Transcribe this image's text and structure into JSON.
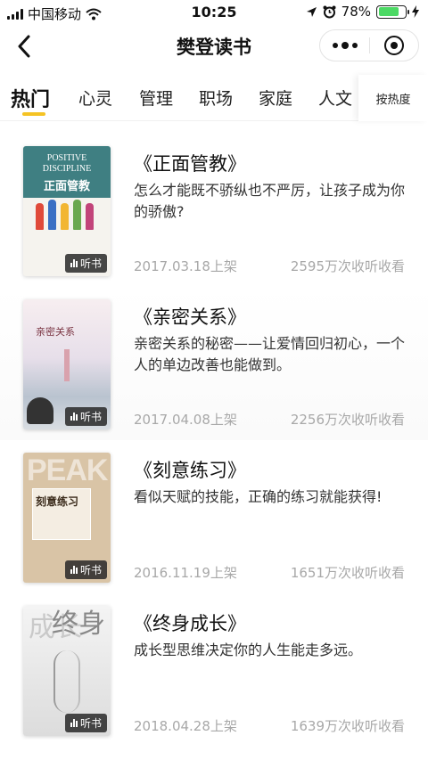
{
  "status_bar": {
    "carrier": "中国移动",
    "time": "10:25",
    "battery": "78%",
    "battery_level": 0.78
  },
  "nav": {
    "title": "樊登读书"
  },
  "tabs": [
    {
      "label": "热门"
    },
    {
      "label": "心灵"
    },
    {
      "label": "管理"
    },
    {
      "label": "职场"
    },
    {
      "label": "家庭"
    },
    {
      "label": "人文"
    }
  ],
  "sort_label": "按热度",
  "colors": {
    "accent": "#f5c324",
    "meta_text": "#a8a8a8"
  },
  "books": [
    {
      "title": "《正面管教》",
      "description": "怎么才能既不骄纵也不严厉，让孩子成为你的骄傲?",
      "date": "2017.03.18上架",
      "listens": "2595万次收听收看",
      "badge": "听书",
      "cover": {
        "en_line1": "POSITIVE",
        "en_line2": "DISCIPLINE",
        "zh": "正面管教"
      }
    },
    {
      "title": "《亲密关系》",
      "description": "亲密关系的秘密——让爱情回归初心，一个人的单边改善也能做到。",
      "date": "2017.04.08上架",
      "listens": "2256万次收听收看",
      "badge": "听书",
      "cover": {
        "zh": "亲密关系"
      }
    },
    {
      "title": "《刻意练习》",
      "description": "看似天赋的技能，正确的练习就能获得!",
      "date": "2016.11.19上架",
      "listens": "1651万次收听收看",
      "badge": "听书",
      "cover": {
        "letters": "PEAK",
        "zh": "刻意练习"
      }
    },
    {
      "title": "《终身成长》",
      "description": "成长型思维决定你的人生能走多远。",
      "date": "2018.04.28上架",
      "listens": "1639万次收听收看",
      "badge": "听书",
      "cover": {
        "zh1": "成长",
        "zh2": "终身"
      }
    }
  ]
}
